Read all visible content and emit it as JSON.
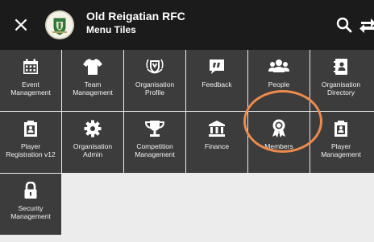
{
  "header": {
    "close_label": "×",
    "title": "Old Reigatian RFC",
    "subtitle": "Menu Tiles"
  },
  "tiles": [
    {
      "label": "Event\nManagement",
      "icon": "calendar-icon"
    },
    {
      "label": "Team\nManagement",
      "icon": "shirt-icon"
    },
    {
      "label": "Organisation\nProfile",
      "icon": "crest-icon"
    },
    {
      "label": "Feedback",
      "icon": "quote-bubble-icon"
    },
    {
      "label": "People",
      "icon": "people-icon"
    },
    {
      "label": "Organisation\nDirectory",
      "icon": "directory-icon"
    },
    {
      "label": "Player\nRegistration v12",
      "icon": "clipboard-icon"
    },
    {
      "label": "Organisation\nAdmin",
      "icon": "gear-icon"
    },
    {
      "label": "Competition\nManagement",
      "icon": "trophy-icon"
    },
    {
      "label": "Finance",
      "icon": "bank-icon"
    },
    {
      "label": "Members",
      "icon": "award-ribbon-icon"
    },
    {
      "label": "Player\nManagement",
      "icon": "clipboard-icon"
    },
    {
      "label": "Security\nManagement",
      "icon": "lock-icon"
    }
  ],
  "colors": {
    "header_bg": "#1b1b1b",
    "tile_bg": "#3c3c3c",
    "page_bg": "#ececec",
    "highlight_ring": "#ee8a4b"
  }
}
